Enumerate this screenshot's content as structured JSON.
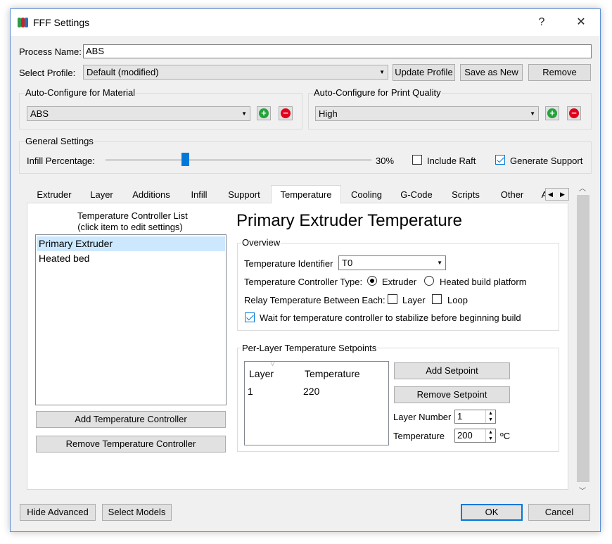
{
  "window": {
    "title": "FFF Settings",
    "help": "?",
    "close": "✕"
  },
  "process": {
    "name_label": "Process Name:",
    "name_value": "ABS",
    "profile_label": "Select Profile:",
    "profile_value": "Default (modified)",
    "update_profile": "Update Profile",
    "save_as_new": "Save as New",
    "remove": "Remove"
  },
  "auto_material": {
    "title": "Auto-Configure for Material",
    "value": "ABS"
  },
  "auto_quality": {
    "title": "Auto-Configure for Print Quality",
    "value": "High"
  },
  "general": {
    "title": "General Settings",
    "infill_label": "Infill Percentage:",
    "infill_value": "30%",
    "infill_fraction": 0.3,
    "include_raft": "Include Raft",
    "include_raft_checked": false,
    "generate_support": "Generate Support",
    "generate_support_checked": true
  },
  "tabs": [
    "Extruder",
    "Layer",
    "Additions",
    "Infill",
    "Support",
    "Temperature",
    "Cooling",
    "G-Code",
    "Scripts",
    "Other",
    "A"
  ],
  "active_tab": "Temperature",
  "temp": {
    "list_title_1": "Temperature Controller List",
    "list_title_2": "(click item to edit settings)",
    "controllers": [
      "Primary Extruder",
      "Heated bed"
    ],
    "add_controller": "Add Temperature Controller",
    "remove_controller": "Remove Temperature Controller",
    "heading": "Primary Extruder Temperature",
    "overview_title": "Overview",
    "identifier_label": "Temperature Identifier",
    "identifier_value": "T0",
    "type_label": "Temperature Controller Type:",
    "type_extruder": "Extruder",
    "type_heated": "Heated build platform",
    "relay_label": "Relay Temperature Between Each:",
    "relay_layer": "Layer",
    "relay_loop": "Loop",
    "wait_label": "Wait for temperature controller to stabilize before beginning build",
    "setpoints_title": "Per-Layer Temperature Setpoints",
    "col_layer": "Layer",
    "col_temperature": "Temperature",
    "rows": [
      {
        "layer": "1",
        "temperature": "220"
      }
    ],
    "add_setpoint": "Add Setpoint",
    "remove_setpoint": "Remove Setpoint",
    "layer_number_label": "Layer Number",
    "layer_number_value": "1",
    "temperature_label": "Temperature",
    "temperature_value": "200",
    "unit": "ºC"
  },
  "footer": {
    "hide_advanced": "Hide Advanced",
    "select_models": "Select Models",
    "ok": "OK",
    "cancel": "Cancel"
  },
  "colors": {
    "accent": "#0078d7",
    "selection": "#cce8ff",
    "add_green": "#22a33a",
    "remove_red": "#e0001b"
  }
}
